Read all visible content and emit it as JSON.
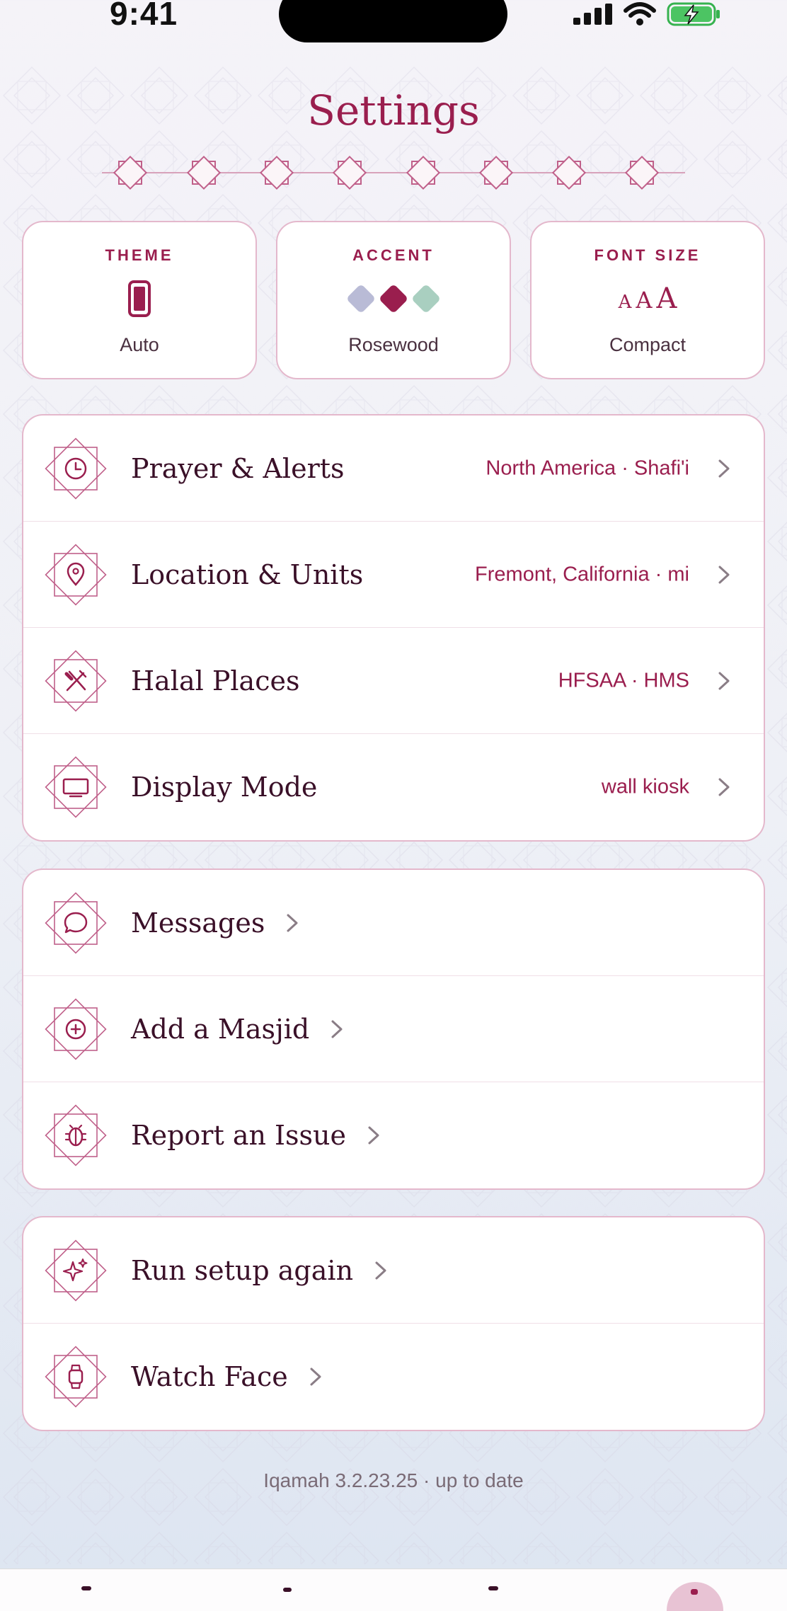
{
  "status_bar": {
    "time": "9:41"
  },
  "header": {
    "title": "Settings"
  },
  "quick_settings": [
    {
      "label": "THEME",
      "value": "Auto",
      "icon": "phone-icon"
    },
    {
      "label": "ACCENT",
      "value": "Rosewood",
      "icon": "accent-swatches",
      "swatches": [
        "#b9bbd6",
        "#9a1e4e",
        "#a9cfc0"
      ]
    },
    {
      "label": "FONT SIZE",
      "value": "Compact",
      "icon": "font-size-icon",
      "glyphs": [
        "A",
        "A",
        "A"
      ]
    }
  ],
  "group1": [
    {
      "label": "Prayer & Alerts",
      "value": "North America · Shafi'i",
      "icon": "clock-icon"
    },
    {
      "label": "Location & Units",
      "value": "Fremont, California · mi",
      "icon": "location-pin-icon"
    },
    {
      "label": "Halal Places",
      "value": "HFSAA · HMS",
      "icon": "utensils-icon"
    },
    {
      "label": "Display Mode",
      "value": "wall kiosk",
      "icon": "monitor-icon"
    }
  ],
  "group2": [
    {
      "label": "Messages",
      "icon": "chat-bubble-icon"
    },
    {
      "label": "Add a Masjid",
      "icon": "plus-circle-icon"
    },
    {
      "label": "Report an Issue",
      "icon": "bug-icon"
    }
  ],
  "group3": [
    {
      "label": "Run setup again",
      "icon": "sparkles-icon"
    },
    {
      "label": "Watch Face",
      "icon": "watch-icon"
    }
  ],
  "footer": {
    "version": "Iqamah 3.2.23.25 · up to date"
  },
  "colors": {
    "accent": "#9a1e4e",
    "border": "#e4b8cc",
    "text": "#3a1028"
  }
}
